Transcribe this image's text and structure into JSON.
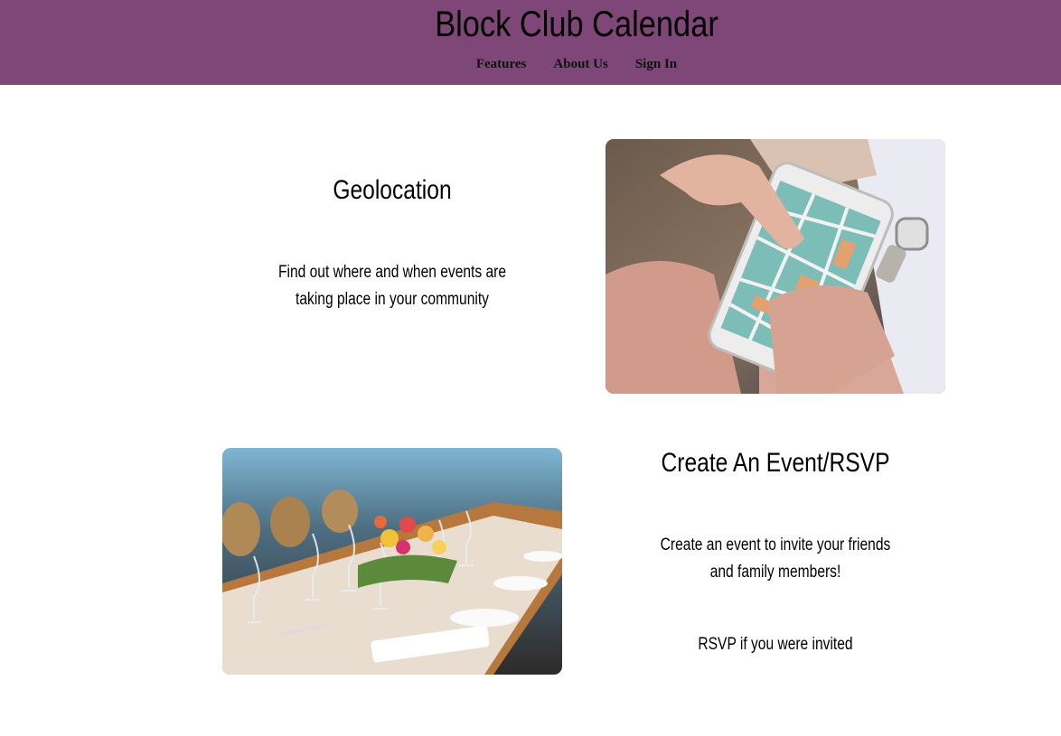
{
  "header": {
    "title": "Block Club Calendar",
    "nav": [
      {
        "label": "Features"
      },
      {
        "label": "About Us"
      },
      {
        "label": "Sign In"
      }
    ]
  },
  "features": [
    {
      "title": "Geolocation",
      "text_lines": [
        "Find out where and when events are",
        "taking place in your community"
      ],
      "image": "phone-map-photo"
    },
    {
      "title": "Create An Event/RSVP",
      "text_lines": [
        "Create an event to invite your friends",
        "and family members!"
      ],
      "extra": "RSVP if you were invited",
      "image": "dinner-table-photo"
    }
  ],
  "colors": {
    "header_bg": "#7e4778"
  }
}
